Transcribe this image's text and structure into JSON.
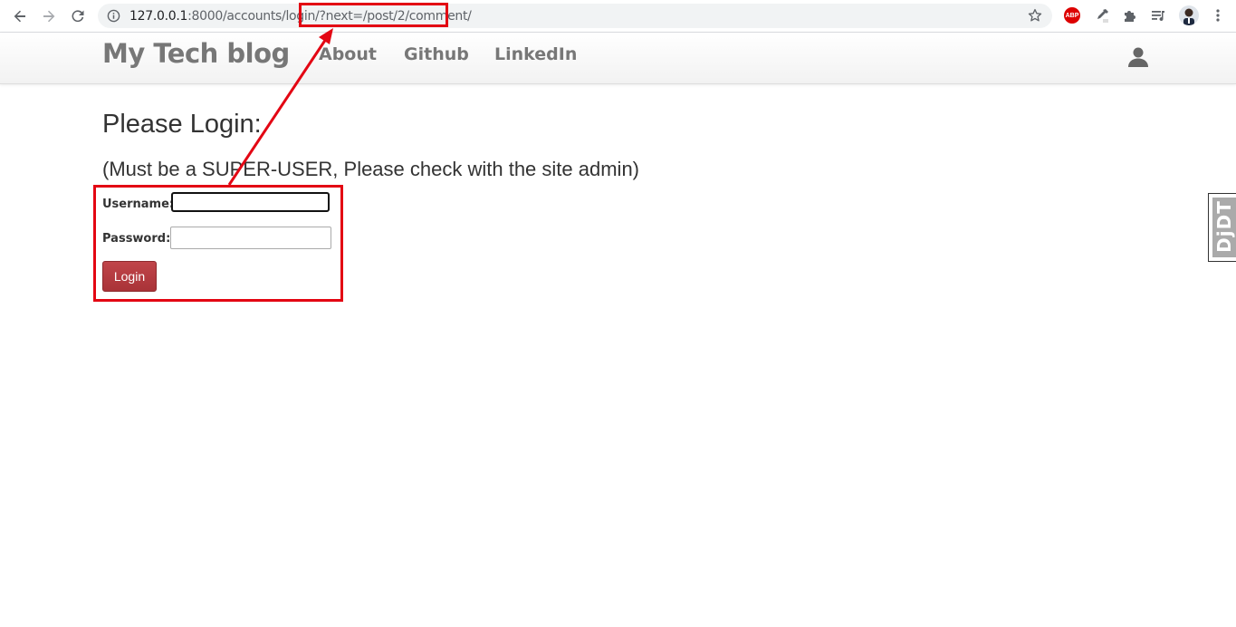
{
  "browser": {
    "url_host": "127.0.0.1",
    "url_rest": ":8000/accounts/login/",
    "url_query": "?next=/post/2/comment/",
    "extension_abp_label": "ABP",
    "icons": [
      "back-icon",
      "forward-icon",
      "reload-icon",
      "info-icon",
      "star-icon",
      "abp-icon",
      "eyedropper-icon",
      "puzzle-icon",
      "media-queue-icon",
      "profile-avatar",
      "menu-icon"
    ]
  },
  "site": {
    "brand": "My Tech blog",
    "nav": [
      "About",
      "Github",
      "LinkedIn"
    ],
    "user_icon": "user-icon"
  },
  "page": {
    "title": "Please Login:",
    "subtitle": "(Must be a SUPER-USER, Please check with the site admin)"
  },
  "form": {
    "username_label": "Username:",
    "username_value": "",
    "password_label": "Password:",
    "password_value": "",
    "submit_label": "Login"
  },
  "debug_toolbar": {
    "label": "DjDT"
  },
  "colors": {
    "annotation": "#e30613",
    "login_button": "#b23a3f",
    "nav_text": "#777777"
  }
}
